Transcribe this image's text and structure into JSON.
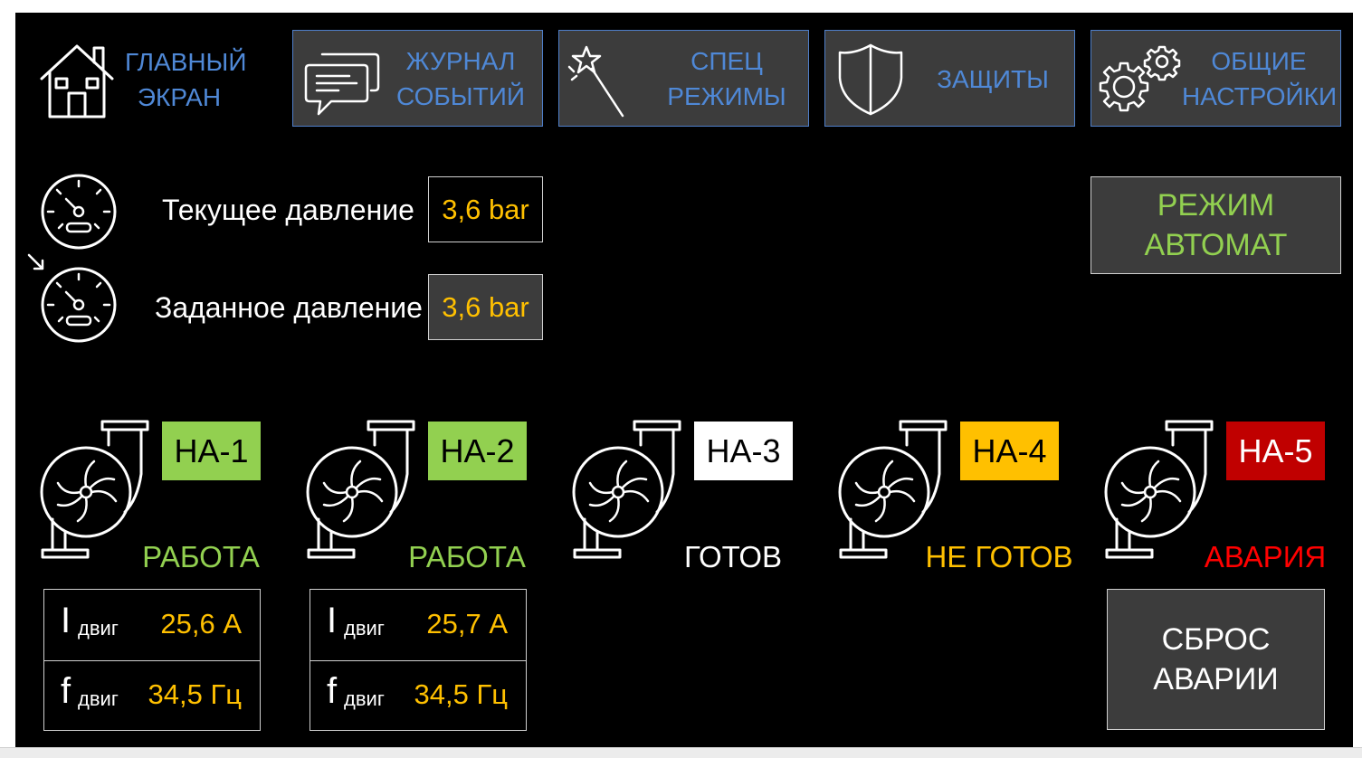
{
  "nav": {
    "home": {
      "line1": "ГЛАВНЫЙ",
      "line2": "ЭКРАН",
      "icon": "home-icon"
    },
    "buttons": [
      {
        "line1": "ЖУРНАЛ",
        "line2": "СОБЫТИЙ",
        "icon": "chat-bubbles-icon"
      },
      {
        "line1": "СПЕЦ",
        "line2": "РЕЖИМЫ",
        "icon": "magic-wand-icon"
      },
      {
        "line1": "ЗАЩИТЫ",
        "line2": "",
        "icon": "shield-icon"
      },
      {
        "line1": "ОБЩИЕ",
        "line2": "НАСТРОЙКИ",
        "icon": "gears-icon"
      }
    ]
  },
  "pressure": {
    "current": {
      "label": "Текущее давление",
      "value": "3,6 bar",
      "icon": "gauge-icon"
    },
    "setpoint": {
      "label": "Заданное давление",
      "value": "3,6 bar",
      "icon": "gauge-setpoint-icon"
    }
  },
  "mode": {
    "line1": "РЕЖИМ",
    "line2": "АВТОМАТ"
  },
  "pumps": [
    {
      "name": "НА-1",
      "status": "РАБОТА",
      "badge_bg": "#92d050",
      "badge_fg": "#000000",
      "status_color": "#92d050",
      "current_symbol": "I",
      "current_sub": "двиг",
      "current": "25,6 А",
      "freq_symbol": "f",
      "freq_sub": "двиг",
      "freq": "34,5 Гц"
    },
    {
      "name": "НА-2",
      "status": "РАБОТА",
      "badge_bg": "#92d050",
      "badge_fg": "#000000",
      "status_color": "#92d050",
      "current_symbol": "I",
      "current_sub": "двиг",
      "current": "25,7 А",
      "freq_symbol": "f",
      "freq_sub": "двиг",
      "freq": "34,5 Гц"
    },
    {
      "name": "НА-3",
      "status": "ГОТОВ",
      "badge_bg": "#ffffff",
      "badge_fg": "#000000",
      "status_color": "#ffffff"
    },
    {
      "name": "НА-4",
      "status": "НЕ ГОТОВ",
      "badge_bg": "#ffc000",
      "badge_fg": "#000000",
      "status_color": "#ffc000"
    },
    {
      "name": "НА-5",
      "status": "АВАРИЯ",
      "badge_bg": "#c00000",
      "badge_fg": "#ffffff",
      "status_color": "#ff0000"
    }
  ],
  "reset": {
    "line1": "СБРОС",
    "line2": "АВАРИИ"
  },
  "colors": {
    "background": "#000000",
    "nav_text": "#4f88d6",
    "value_text": "#ffc000",
    "ok_green": "#92d050",
    "panel": "#3c3c3c"
  }
}
